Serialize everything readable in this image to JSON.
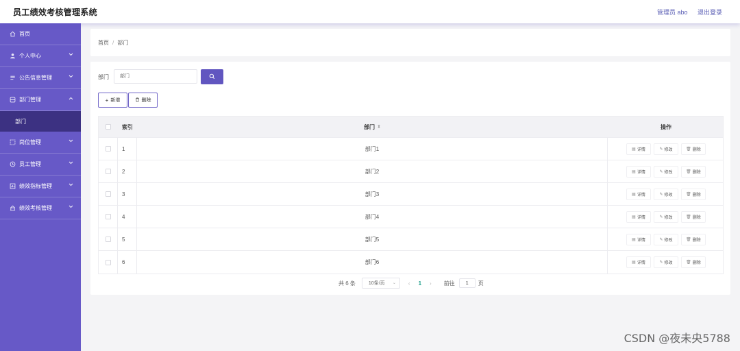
{
  "header": {
    "title": "员工绩效考核管理系统",
    "user": "管理员 abo",
    "logout": "退出登录"
  },
  "sidebar": {
    "items": [
      {
        "label": "首页",
        "icon": "home-icon"
      },
      {
        "label": "个人中心",
        "icon": "user-icon"
      },
      {
        "label": "公告信息管理",
        "icon": "notice-icon"
      },
      {
        "label": "部门管理",
        "icon": "dept-icon"
      },
      {
        "label": "岗位管理",
        "icon": "position-icon"
      },
      {
        "label": "员工管理",
        "icon": "employee-icon"
      },
      {
        "label": "绩效指标管理",
        "icon": "indicator-icon"
      },
      {
        "label": "绩效考核管理",
        "icon": "assessment-icon"
      }
    ],
    "active_sub": "部门"
  },
  "breadcrumb": {
    "home": "首页",
    "sep": "/",
    "current": "部门"
  },
  "search": {
    "label": "部门",
    "placeholder": "部门"
  },
  "toolbar": {
    "add": "新增",
    "delete": "删除"
  },
  "table": {
    "headers": {
      "index": "索引",
      "dept": "部门",
      "ops": "操作"
    },
    "rows": [
      {
        "index": "1",
        "dept": "部门1"
      },
      {
        "index": "2",
        "dept": "部门2"
      },
      {
        "index": "3",
        "dept": "部门3"
      },
      {
        "index": "4",
        "dept": "部门4"
      },
      {
        "index": "5",
        "dept": "部门5"
      },
      {
        "index": "6",
        "dept": "部门6"
      }
    ],
    "ops": {
      "detail": "详情",
      "edit": "修改",
      "delete": "删除"
    }
  },
  "pagination": {
    "total": "共 6 条",
    "page_size": "10条/页",
    "current_page": "1",
    "goto_label": "前往",
    "goto_value": "1",
    "goto_suffix": "页"
  },
  "watermark": "CSDN @夜未央5788",
  "colors": {
    "sidebar": "#6759c7",
    "sidebar_active": "#3c3182",
    "primary": "#6156c0",
    "page_active": "#1e9e8a"
  }
}
